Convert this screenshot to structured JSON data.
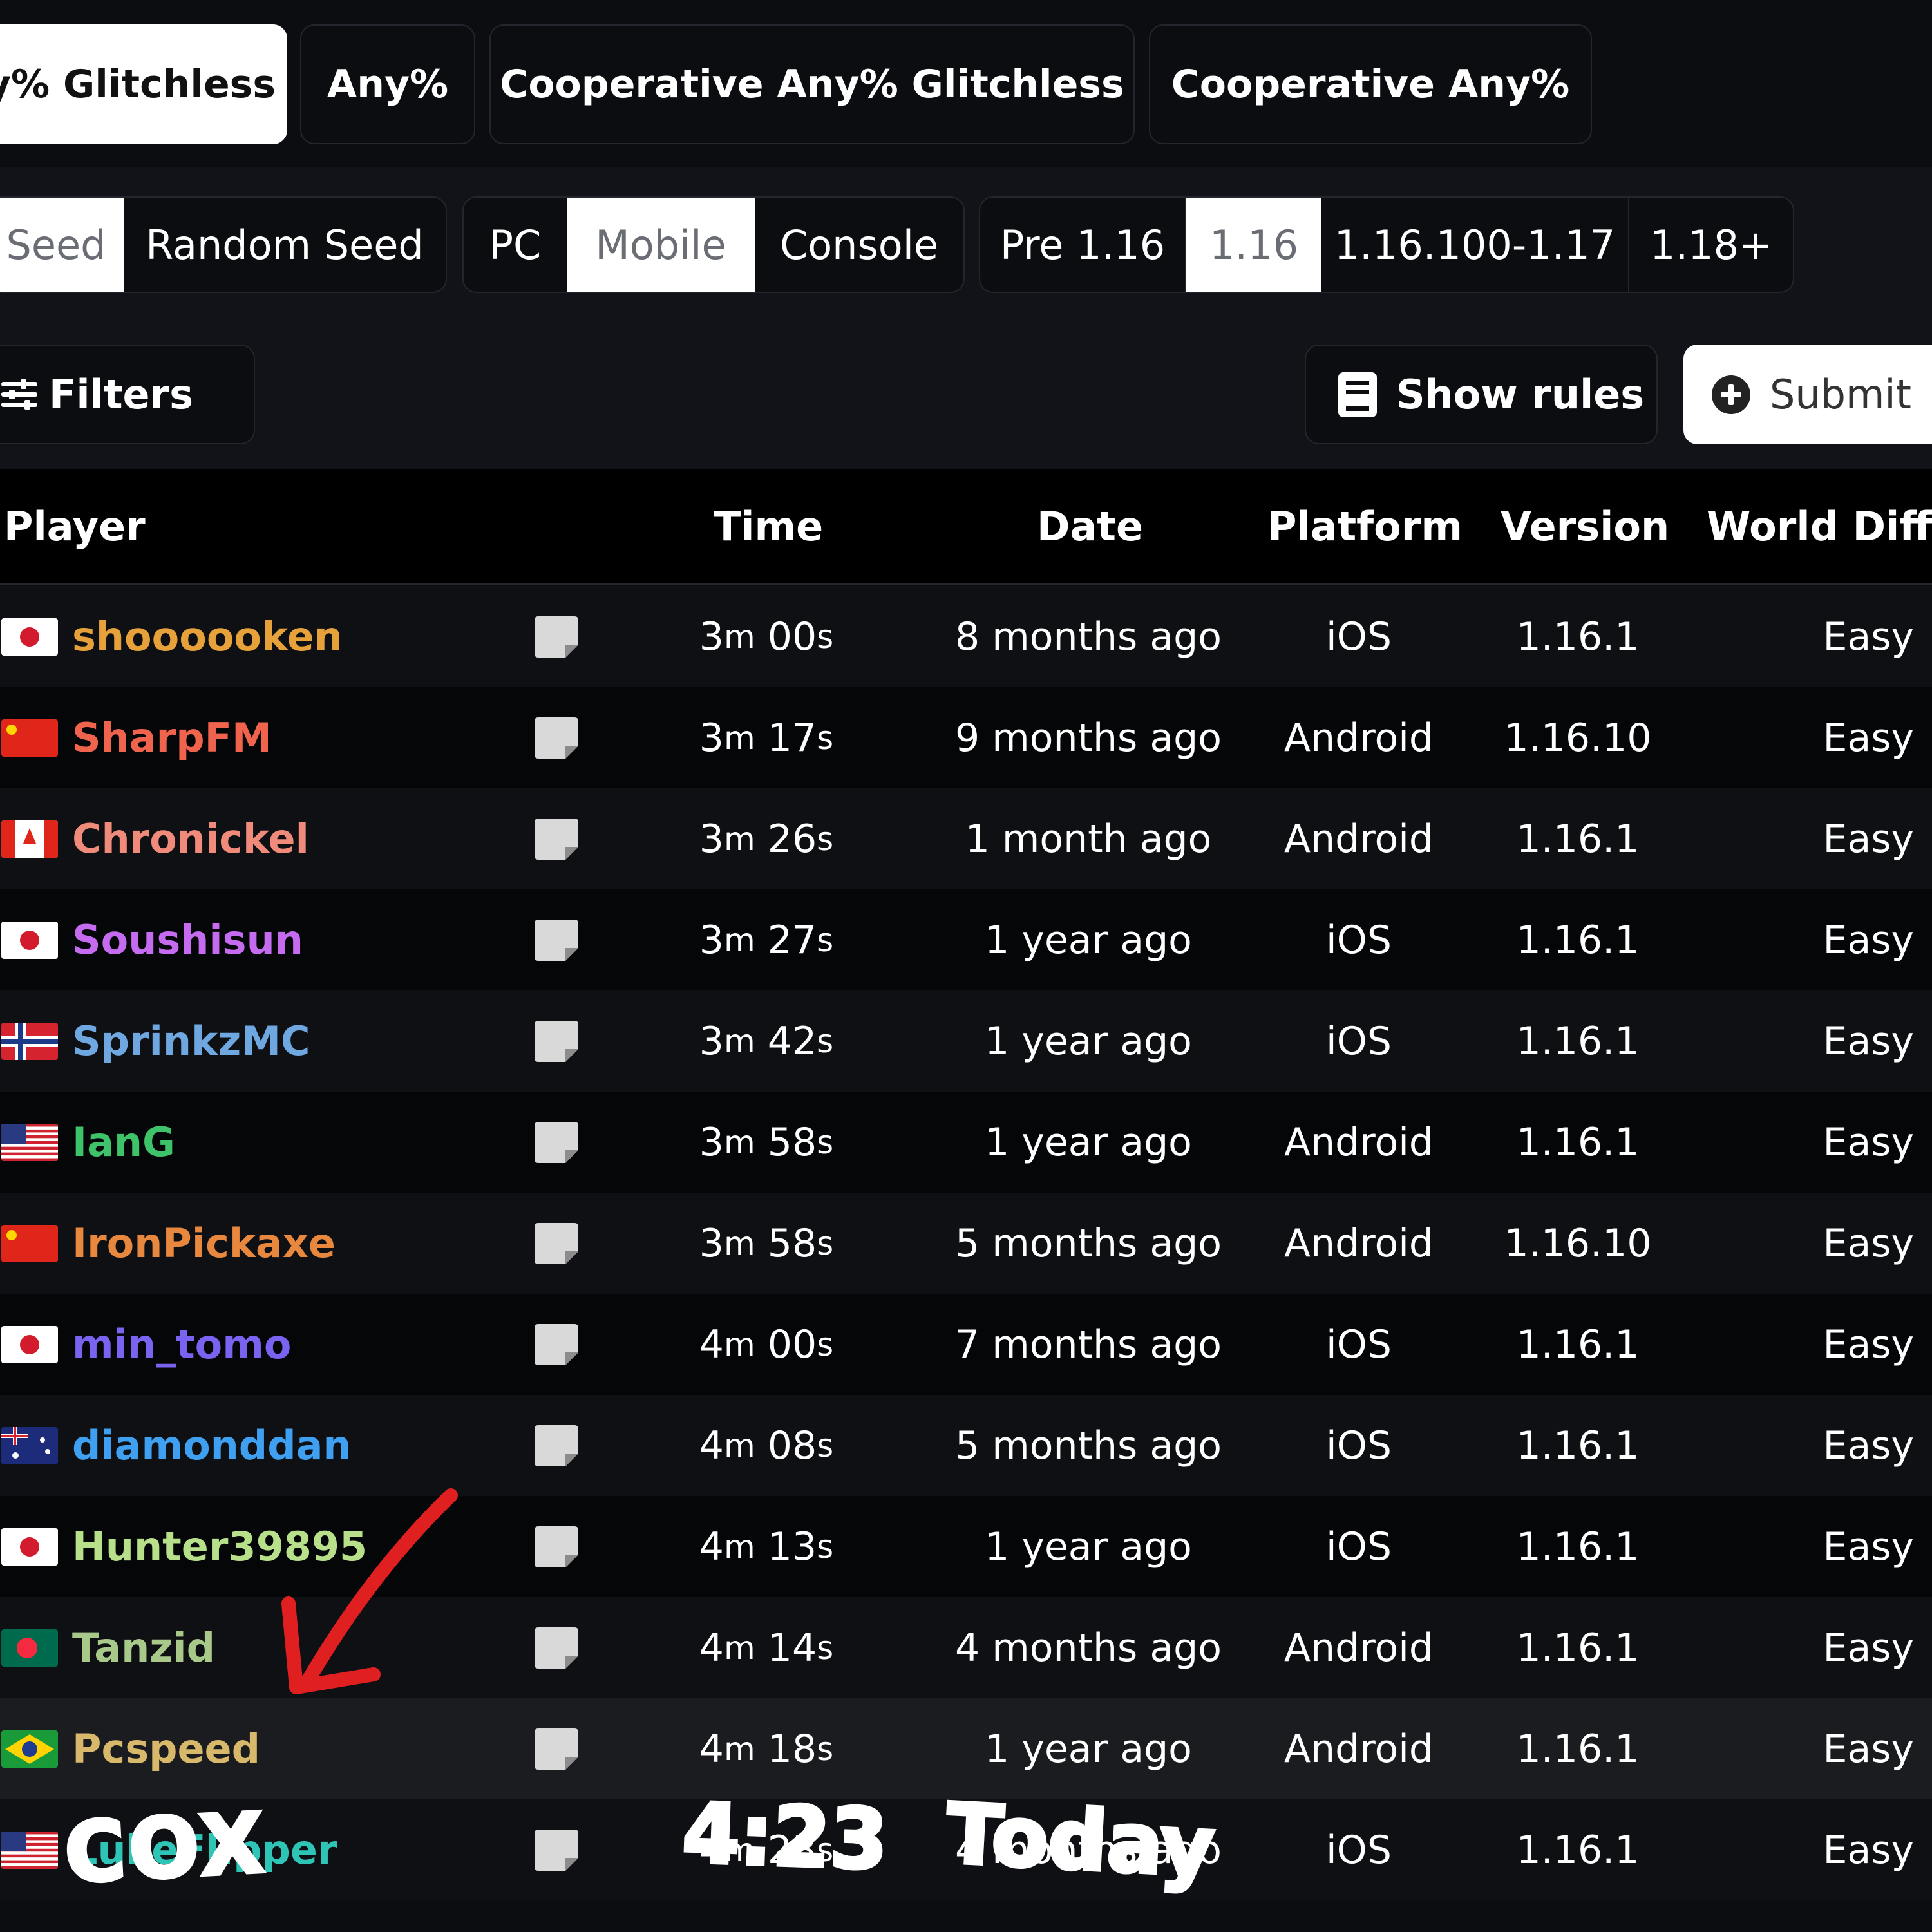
{
  "category_tabs": [
    {
      "label": "y% Glitchless",
      "active": true
    },
    {
      "label": "Any%",
      "active": false
    },
    {
      "label": "Cooperative Any% Glitchless",
      "active": false
    },
    {
      "label": "Cooperative Any%",
      "active": false
    }
  ],
  "seed_filter": [
    {
      "label": "Seed",
      "active": true
    },
    {
      "label": "Random Seed",
      "active": false
    }
  ],
  "platform_filter": [
    {
      "label": "PC",
      "active": false
    },
    {
      "label": "Mobile",
      "active": true
    },
    {
      "label": "Console",
      "active": false
    }
  ],
  "version_filter": [
    {
      "label": "Pre 1.16",
      "active": false
    },
    {
      "label": "1.16",
      "active": true
    },
    {
      "label": "1.16.100-1.17",
      "active": false
    },
    {
      "label": "1.18+",
      "active": false
    }
  ],
  "toolbar": {
    "filters_label": "Filters",
    "show_rules_label": "Show rules",
    "submit_label": "Submit"
  },
  "table": {
    "headers": {
      "player": "Player",
      "time": "Time",
      "date": "Date",
      "platform": "Platform",
      "version": "Version",
      "world_difficulty": "World Diffi"
    },
    "rows": [
      {
        "player": "shoooooken",
        "flag": "japan",
        "name_color": "#e6a13a",
        "time_m": "3",
        "time_s": "00",
        "date": "8 months ago",
        "platform": "iOS",
        "version": "1.16.1",
        "difficulty": "Easy"
      },
      {
        "player": "SharpFM",
        "flag": "china",
        "name_color": "#f0644e",
        "time_m": "3",
        "time_s": "17",
        "date": "9 months ago",
        "platform": "Android",
        "version": "1.16.10",
        "difficulty": "Easy"
      },
      {
        "player": "Chronickel",
        "flag": "canada",
        "name_color": "#f08a7a",
        "time_m": "3",
        "time_s": "26",
        "date": "1 month ago",
        "platform": "Android",
        "version": "1.16.1",
        "difficulty": "Easy"
      },
      {
        "player": "Soushisun",
        "flag": "japan",
        "name_color": "#c56bf0",
        "time_m": "3",
        "time_s": "27",
        "date": "1 year ago",
        "platform": "iOS",
        "version": "1.16.1",
        "difficulty": "Easy"
      },
      {
        "player": "SprinkzMC",
        "flag": "norway",
        "name_color": "#6fa7e0",
        "time_m": "3",
        "time_s": "42",
        "date": "1 year ago",
        "platform": "iOS",
        "version": "1.16.1",
        "difficulty": "Easy"
      },
      {
        "player": "IanG",
        "flag": "usa",
        "name_color": "#3fc36a",
        "time_m": "3",
        "time_s": "58",
        "date": "1 year ago",
        "platform": "Android",
        "version": "1.16.1",
        "difficulty": "Easy"
      },
      {
        "player": "IronPickaxe",
        "flag": "china",
        "name_color": "#e8883e",
        "time_m": "3",
        "time_s": "58",
        "date": "5 months ago",
        "platform": "Android",
        "version": "1.16.10",
        "difficulty": "Easy"
      },
      {
        "player": "min_tomo",
        "flag": "japan",
        "name_color": "#7a63f0",
        "time_m": "4",
        "time_s": "00",
        "date": "7 months ago",
        "platform": "iOS",
        "version": "1.16.1",
        "difficulty": "Easy"
      },
      {
        "player": "diamonddan",
        "flag": "australia",
        "name_color": "#3f9ff0",
        "time_m": "4",
        "time_s": "08",
        "date": "5 months ago",
        "platform": "iOS",
        "version": "1.16.1",
        "difficulty": "Easy"
      },
      {
        "player": "Hunter39895",
        "flag": "japan",
        "name_color": "#b8e08a",
        "time_m": "4",
        "time_s": "13",
        "date": "1 year ago",
        "platform": "iOS",
        "version": "1.16.1",
        "difficulty": "Easy"
      },
      {
        "player": "Tanzid",
        "flag": "bangladesh",
        "name_color": "#a8c98a",
        "time_m": "4",
        "time_s": "14",
        "date": "4 months ago",
        "platform": "Android",
        "version": "1.16.1",
        "difficulty": "Easy"
      },
      {
        "player": "Pcspeed",
        "flag": "brazil",
        "name_color": "#d8b86a",
        "time_m": "4",
        "time_s": "18",
        "date": "1 year ago",
        "platform": "Android",
        "version": "1.16.1",
        "difficulty": "Easy"
      },
      {
        "player": "LukeFlipper",
        "flag": "usa",
        "name_color": "#2ec4b6",
        "time_m": "4",
        "time_s": "23",
        "date": "4 months ago",
        "platform": "iOS",
        "version": "1.16.1",
        "difficulty": "Easy"
      }
    ]
  },
  "annotations": {
    "name_scribble": "COX",
    "time_scribble": "4:23",
    "date_scribble": "Today",
    "arrow_color": "#e02020"
  }
}
